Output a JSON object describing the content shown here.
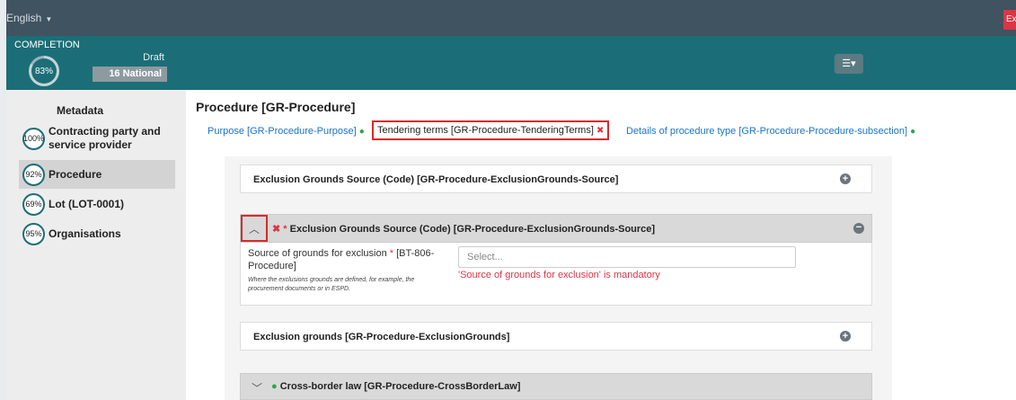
{
  "topbar": {
    "language": "English",
    "exit_label": "Exit"
  },
  "completion": {
    "label": "COMPLETION",
    "percent_text": "83%",
    "percent_value": 83,
    "status_top": "Draft",
    "status_pill": "16 National"
  },
  "sidebar": {
    "title": "Metadata",
    "items": [
      {
        "pct": "100%",
        "label": "Contracting party and service provider",
        "active": false
      },
      {
        "pct": "92%",
        "label": "Procedure",
        "active": true
      },
      {
        "pct": "69%",
        "label": "Lot (LOT-0001)",
        "active": false
      },
      {
        "pct": "95%",
        "label": "Organisations",
        "active": false
      }
    ]
  },
  "main": {
    "title": "Procedure [GR-Procedure]",
    "tabs": [
      {
        "label": "Purpose [GR-Procedure-Purpose]",
        "status": "ok"
      },
      {
        "label": "Tendering terms [GR-Procedure-TenderingTerms]",
        "status": "error"
      },
      {
        "label": "Details of procedure type [GR-Procedure-Procedure-subsection]",
        "status": "ok"
      }
    ],
    "section1": {
      "title": "Exclusion Grounds Source (Code) [GR-Procedure-ExclusionGrounds-Source]"
    },
    "expanded": {
      "required_mark": "*",
      "title": "Exclusion Grounds Source (Code) [GR-Procedure-ExclusionGrounds-Source]",
      "field_label": "Source of grounds for exclusion",
      "field_code": "[BT-806-Procedure]",
      "field_help": "Where the exclusions grounds are defined, for example, the procurement documents or in ESPD.",
      "select_placeholder": "Select...",
      "error": "'Source of grounds for exclusion' is mandatory"
    },
    "section3": {
      "title": "Exclusion grounds [GR-Procedure-ExclusionGrounds]"
    },
    "section4": {
      "title": "Cross-border law [GR-Procedure-CrossBorderLaw]"
    }
  },
  "colors": {
    "topbar": "#3f5360",
    "band": "#1b6e77",
    "link": "#1a73c9",
    "ok": "#28a745",
    "error": "#dc3545",
    "highlight": "#d92a2a"
  }
}
